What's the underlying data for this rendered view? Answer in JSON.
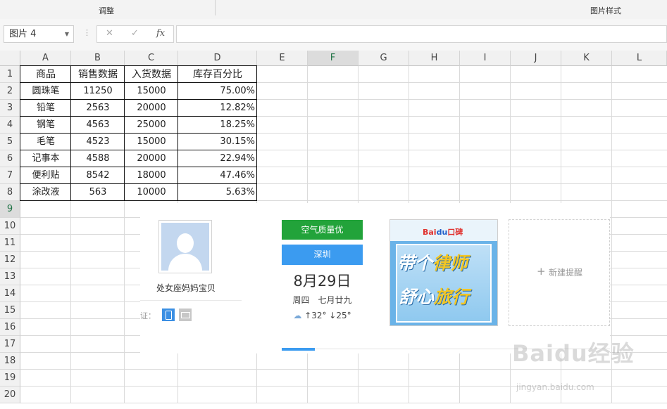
{
  "ribbon": {
    "group_adjust": "调整",
    "group_picture_style": "图片样式"
  },
  "formula_bar": {
    "name_box": "图片 4",
    "more_glyph": "⋮",
    "cancel_glyph": "✕",
    "enter_glyph": "✓",
    "fx_glyph": "fx",
    "formula_value": ""
  },
  "columns": [
    "A",
    "B",
    "C",
    "D",
    "E",
    "F",
    "G",
    "H",
    "I",
    "J",
    "K",
    "L"
  ],
  "selected_column": "F",
  "rows": [
    "1",
    "2",
    "3",
    "4",
    "5",
    "6",
    "7",
    "8",
    "9",
    "10",
    "11",
    "12",
    "13",
    "14",
    "15",
    "16",
    "17",
    "18",
    "19",
    "20"
  ],
  "selected_row": "9",
  "table": {
    "headers": [
      "商品",
      "销售数据",
      "入货数据",
      "库存百分比"
    ],
    "rows": [
      [
        "圆珠笔",
        "11250",
        "15000",
        "75.00%"
      ],
      [
        "铅笔",
        "2563",
        "20000",
        "12.82%"
      ],
      [
        "钢笔",
        "4563",
        "25000",
        "18.25%"
      ],
      [
        "毛笔",
        "4523",
        "15000",
        "30.15%"
      ],
      [
        "记事本",
        "4588",
        "20000",
        "22.94%"
      ],
      [
        "便利贴",
        "8542",
        "18000",
        "47.46%"
      ],
      [
        "涂改液",
        "563",
        "10000",
        "5.63%"
      ]
    ]
  },
  "widget": {
    "username": "处女座妈妈宝贝",
    "verify_label": "证：",
    "air_quality": "空气质量优",
    "city": "深圳",
    "date": "8月29日",
    "weekday_lunar": "周四　七月廿九",
    "temperature": "↑32° ↓25°",
    "ad_logo_prefix": "Bai",
    "ad_logo_mid": "du",
    "ad_logo_suffix": "口碑",
    "ad_line1a": "带个",
    "ad_line1b": "律师",
    "ad_line2a": "舒心",
    "ad_line2b": "旅行",
    "new_reminder": "新建提醒",
    "progress": 0.1
  },
  "watermark": {
    "brand": "Baidu经验",
    "url": "jingyan.baidu.com"
  },
  "icons": [
    "dropdown-icon",
    "more-icon",
    "cancel-icon",
    "enter-icon",
    "fx-icon",
    "avatar-icon",
    "phone-icon",
    "mail-icon",
    "weather-icon",
    "plus-icon"
  ]
}
